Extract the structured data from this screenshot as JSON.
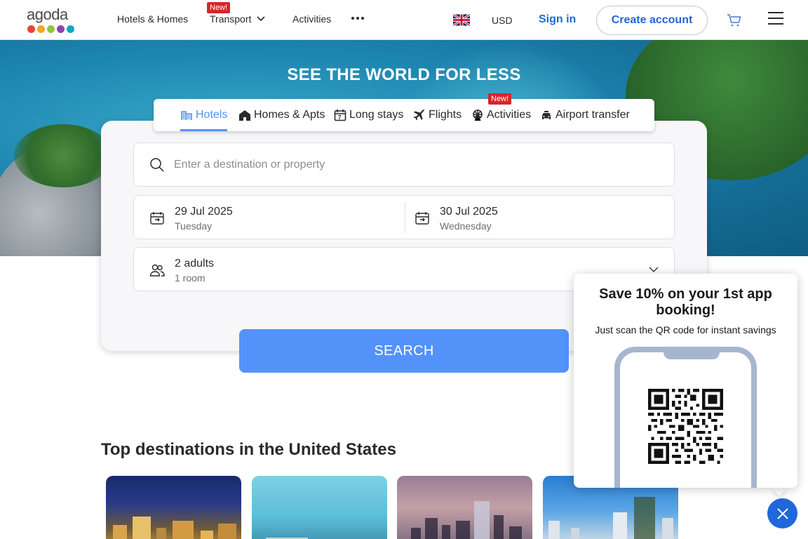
{
  "header": {
    "logo_text": "agoda",
    "logo_colors": [
      "#e94335",
      "#f5a623",
      "#8dc63f",
      "#8e44ad",
      "#0fa7c7"
    ],
    "nav": {
      "hotels_homes": "Hotels & Homes",
      "transport": "Transport",
      "transport_badge": "New!",
      "activities": "Activities"
    },
    "currency": "USD",
    "sign_in": "Sign in",
    "create_account": "Create account"
  },
  "hero": {
    "title": "SEE THE WORLD FOR LESS"
  },
  "tabs": {
    "hotels": "Hotels",
    "homes_apts": "Homes & Apts",
    "long_stays": "Long stays",
    "flights": "Flights",
    "activities": "Activities",
    "activities_badge": "New!",
    "airport_transfer": "Airport transfer",
    "active": "hotels"
  },
  "search": {
    "destination_placeholder": "Enter a destination or property",
    "checkin_date": "29 Jul 2025",
    "checkin_day": "Tuesday",
    "checkout_date": "30 Jul 2025",
    "checkout_day": "Wednesday",
    "guests_main": "2 adults",
    "guests_sub": "1 room",
    "button": "SEARCH"
  },
  "destinations": {
    "title": "Top destinations in the United States"
  },
  "popup": {
    "title": "Save 10% on your 1st app booking!",
    "subtitle": "Just scan the QR code for instant savings"
  },
  "colors": {
    "accent": "#5392f9",
    "link": "#2067da",
    "badge": "#d6262a"
  }
}
